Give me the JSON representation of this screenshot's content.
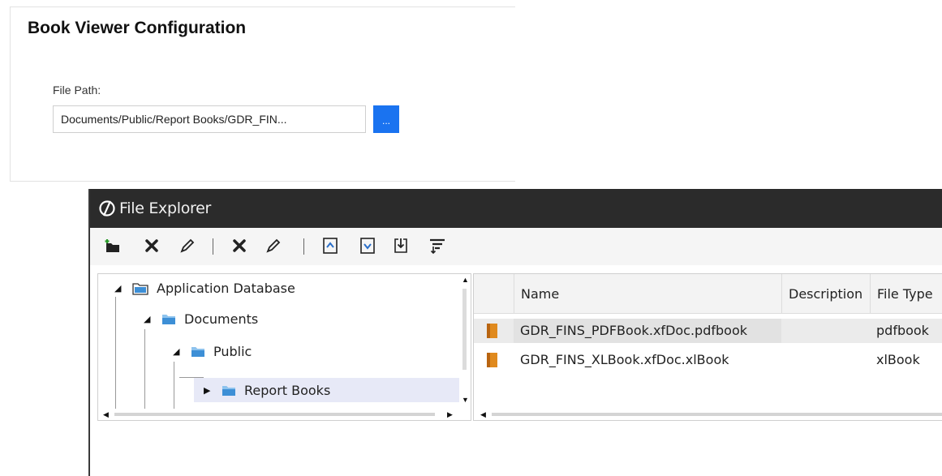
{
  "config": {
    "title": "Book Viewer Configuration",
    "file_path_label": "File Path:",
    "file_path_value": "Documents/Public/Report Books/GDR_FIN...",
    "browse_label": "..."
  },
  "explorer": {
    "title": "File Explorer",
    "toolbar": [
      {
        "name": "add-folder-icon"
      },
      {
        "name": "delete-icon"
      },
      {
        "name": "edit-icon"
      },
      {
        "name": "delete-file-icon"
      },
      {
        "name": "edit-file-icon"
      },
      {
        "name": "upload-icon"
      },
      {
        "name": "download-icon"
      },
      {
        "name": "import-icon"
      },
      {
        "name": "filter-icon"
      }
    ],
    "tree": [
      {
        "label": "Application Database",
        "expanded": true,
        "level": 0
      },
      {
        "label": "Documents",
        "expanded": true,
        "level": 1
      },
      {
        "label": "Public",
        "expanded": true,
        "level": 2
      },
      {
        "label": "Report Books",
        "expanded": false,
        "level": 3,
        "selected": true
      }
    ],
    "grid": {
      "columns": [
        "Name",
        "Description",
        "File Type"
      ],
      "rows": [
        {
          "name": "GDR_FINS_PDFBook.xfDoc.pdfbook",
          "description": "",
          "file_type": "pdfbook"
        },
        {
          "name": "GDR_FINS_XLBook.xfDoc.xlBook",
          "description": "",
          "file_type": "xlBook"
        }
      ]
    }
  },
  "colors": {
    "accent_button": "#1a73f0",
    "titlebar": "#2b2b2b",
    "folder": "#3d8fd6",
    "book_icon": "#e08a1e",
    "selection": "#e7e9f7"
  }
}
